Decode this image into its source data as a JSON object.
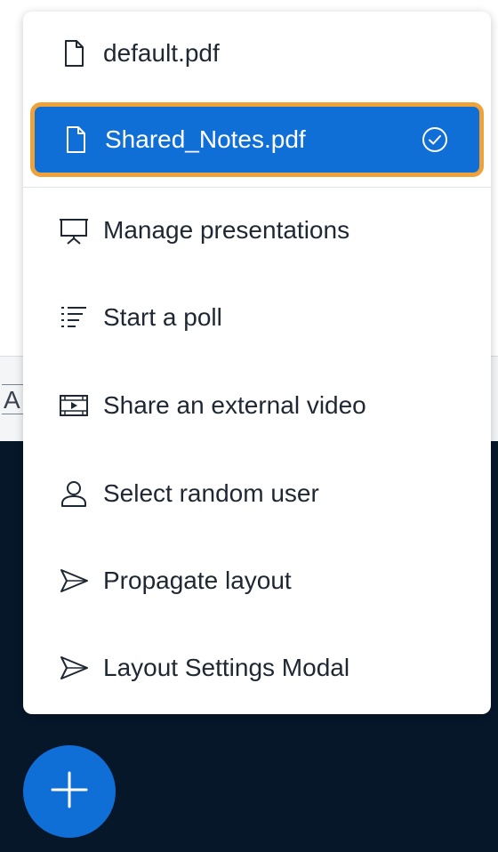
{
  "background": {
    "toolbar_glyph": "A"
  },
  "menu": {
    "items": [
      {
        "label": "default.pdf",
        "icon": "file-icon",
        "selected": false
      },
      {
        "label": "Shared_Notes.pdf",
        "icon": "file-icon",
        "selected": true
      },
      {
        "label": "Manage presentations",
        "icon": "presentation-icon",
        "selected": false
      },
      {
        "label": "Start a poll",
        "icon": "poll-list-icon",
        "selected": false
      },
      {
        "label": "Share an external video",
        "icon": "video-icon",
        "selected": false
      },
      {
        "label": "Select random user",
        "icon": "user-icon",
        "selected": false
      },
      {
        "label": "Propagate layout",
        "icon": "send-icon",
        "selected": false
      },
      {
        "label": "Layout Settings Modal",
        "icon": "send-icon",
        "selected": false
      }
    ]
  },
  "fab": {
    "icon": "plus-icon"
  },
  "colors": {
    "accent": "#0f6fd6",
    "focus_ring": "#f0a23a",
    "dark_background": "#06172a",
    "text": "#1f2733"
  }
}
